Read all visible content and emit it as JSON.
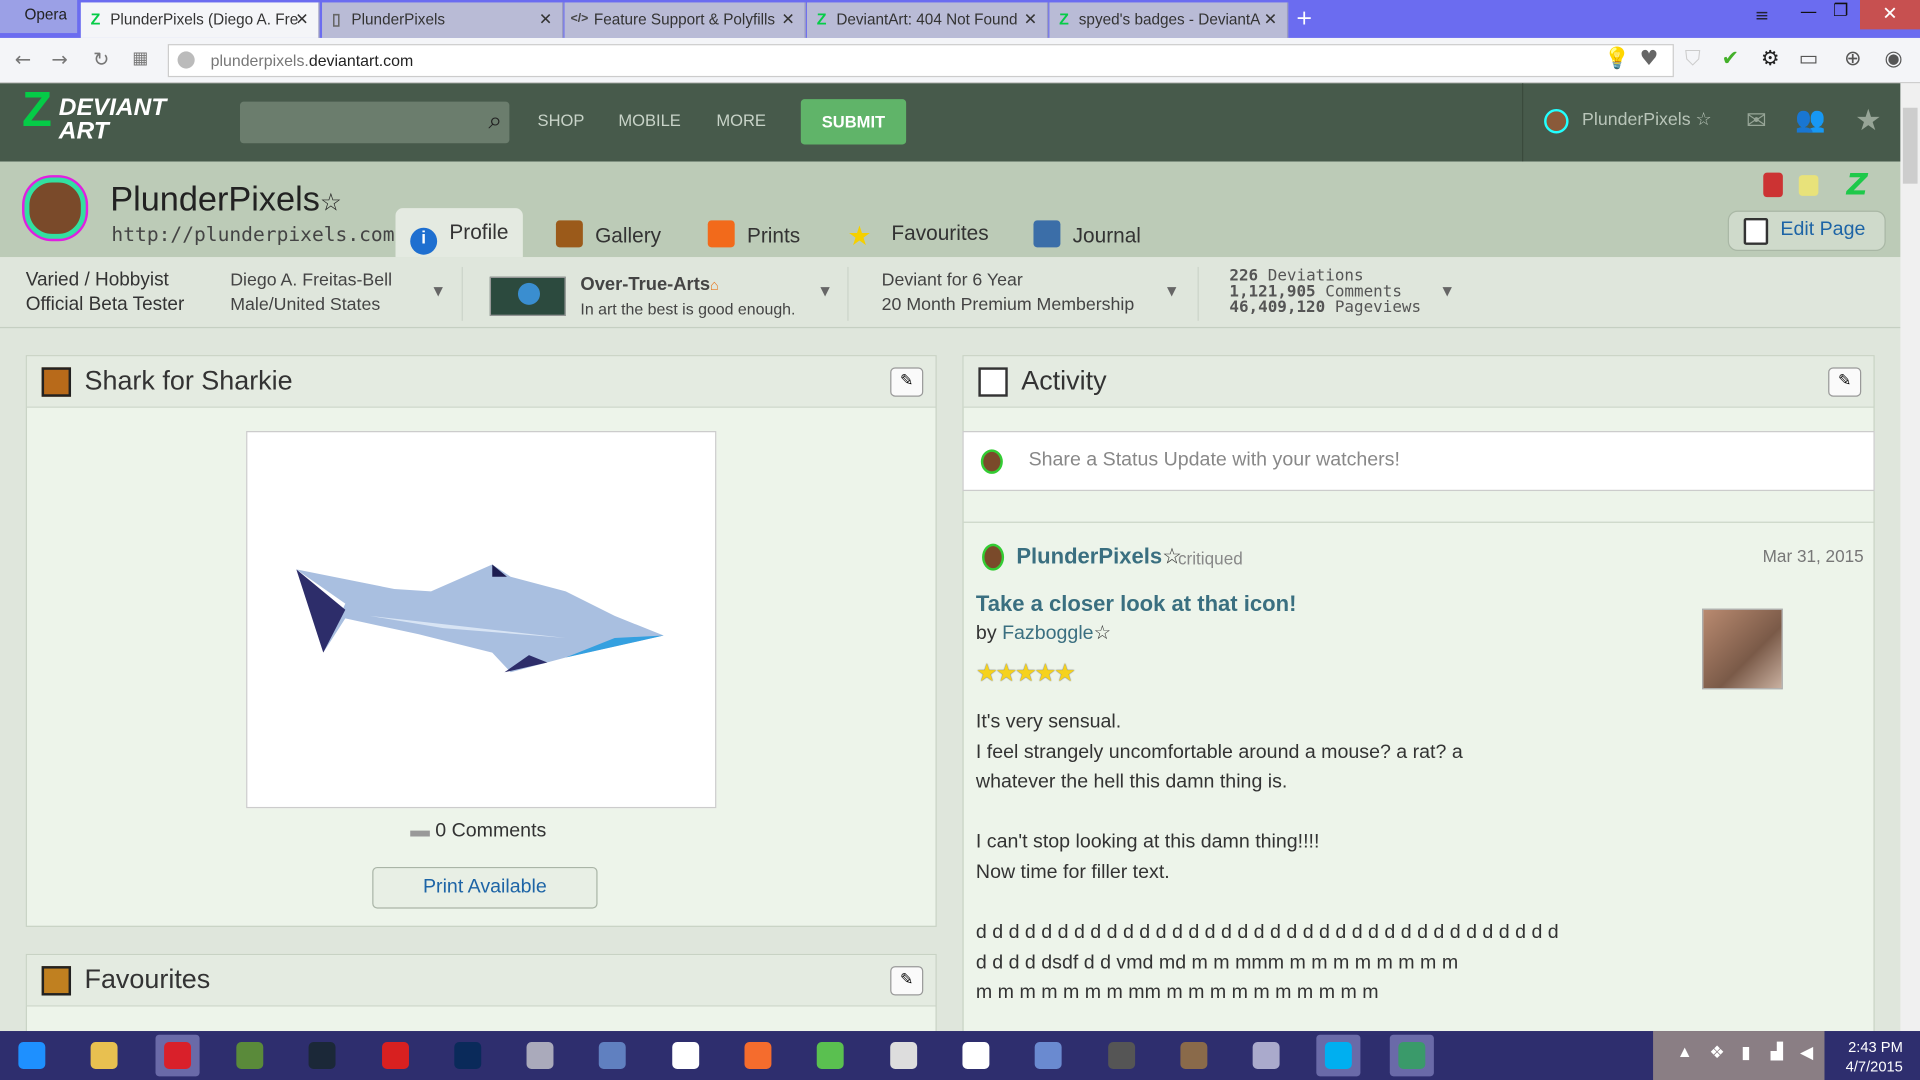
{
  "browser": {
    "opera_label": "Opera",
    "tabs": [
      {
        "title": "PlunderPixels (Diego A. Fre",
        "active": true
      },
      {
        "title": "PlunderPixels",
        "active": false
      },
      {
        "title": "Feature Support & Polyfills",
        "active": false
      },
      {
        "title": "DeviantArt: 404 Not Found",
        "active": false
      },
      {
        "title": "spyed's badges - DeviantA",
        "active": false
      }
    ],
    "url_sub": "plunderpixels.",
    "url_domain": "deviantart.com"
  },
  "header": {
    "logo_line1": "DEVIANT",
    "logo_line2": "ART",
    "search_placeholder": "",
    "menu": [
      "SHOP",
      "MOBILE",
      "MORE"
    ],
    "submit": "SUBMIT",
    "username": "PlunderPixels",
    "brand_color": "#05cc47"
  },
  "profile": {
    "name": "PlunderPixels",
    "site": "http://plunderpixels.com/",
    "tabs": [
      "Profile",
      "Gallery",
      "Prints",
      "Favourites",
      "Journal"
    ],
    "edit_page": "Edit Page",
    "type_line1": "Varied / Hobbyist",
    "type_line2": "Official Beta Tester",
    "real_name": "Diego A. Freitas-Bell",
    "location": "Male/United States",
    "group_name": "Over-True-Arts",
    "group_tagline": "In art the best is good enough.",
    "deviant_for": "Deviant for 6 Year",
    "premium": "20 Month Premium Membership",
    "stats": [
      {
        "num": "226",
        "label": "Deviations"
      },
      {
        "num": "1,121,905",
        "label": "Comments"
      },
      {
        "num": "46,409,120",
        "label": "Pageviews"
      }
    ]
  },
  "featured": {
    "title": "Shark for Sharkie",
    "comments": "0 Comments",
    "print": "Print Available"
  },
  "favourites": {
    "title": "Favourites"
  },
  "activity": {
    "title": "Activity",
    "status_placeholder": "Share a Status Update with your watchers!",
    "user": "PlunderPixels",
    "action": "critiqued",
    "date": "Mar 31, 2015",
    "critique_title": "Take a closer look at that icon!",
    "by": "by",
    "artist": "Fazboggle",
    "rating": 5,
    "lines": [
      "It's very sensual.",
      "I feel strangely uncomfortable around a mouse? a rat? a",
      "whatever the hell this damn thing is.",
      "",
      "I can't stop looking at this damn thing!!!!",
      "Now time for filler text.",
      "",
      "d d d d d d d d d d d d d d d d d d d d d d d d d d d d d d d d d d d d",
      "d d d d dsdf d d vmd md m m mmm m m m m m m m m",
      "m m m m m m m mm m m m m m m m m m m"
    ]
  },
  "taskbar": {
    "time": "2:43 PM",
    "date": "4/7/2015",
    "apps": [
      "start",
      "file-explorer",
      "opera",
      "minecraft",
      "steam",
      "creative-cloud",
      "photoshop",
      "disk",
      "paint",
      "document",
      "origin",
      "world",
      "ragdoll",
      "document2",
      "notepad",
      "video",
      "game",
      "network",
      "skype",
      "atom"
    ]
  }
}
